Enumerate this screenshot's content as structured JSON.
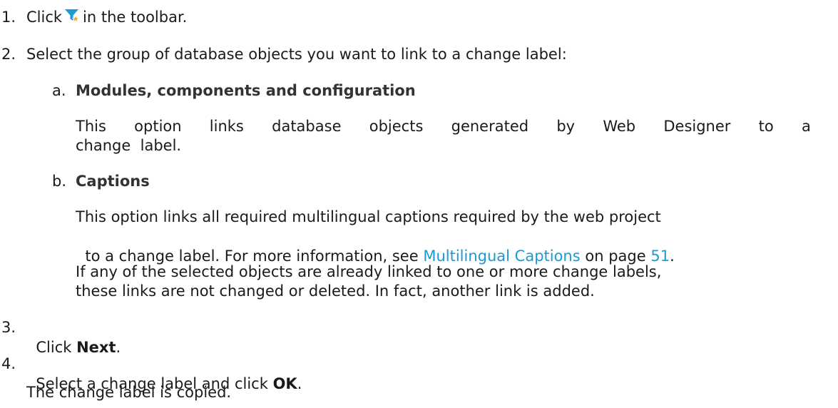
{
  "steps": [
    {
      "number": "1.",
      "before": "Click",
      "icon": "filter-star-icon",
      "after": "in the toolbar."
    },
    {
      "number": "2.",
      "text": "Select the group of database objects you want to link to a change label:",
      "options": [
        {
          "letter": "a.",
          "title": "Modules, components and configuration",
          "desc_line1": [
            "This option links database objects generated by Web Designer to a"
          ],
          "desc_line2": "change  label."
        },
        {
          "letter": "b.",
          "title": "Captions",
          "desc_line1": "This option links all required multilingual captions required by the web project",
          "desc_line2_before": "to a change label. For more information, see ",
          "desc_line2_link": "Multilingual Captions",
          "desc_line2_mid": " on page ",
          "desc_line2_page": "51",
          "desc_line2_after": ".",
          "note_line1": "If any of the selected objects are already linked to one or more change labels,",
          "note_line2": "these links are not changed or deleted. In fact, another link is added."
        }
      ]
    },
    {
      "number": "3.",
      "before": "Click ",
      "bold": "Next",
      "after": "."
    },
    {
      "number": "4.",
      "before": "Select a change label and click ",
      "bold": "OK",
      "after": ".",
      "result": "The change label is copied."
    }
  ],
  "colors": {
    "text": "#1a1a1a",
    "link": "#1a9ad6",
    "icon_funnel": "#1b9bd7",
    "icon_star": "#f5a623"
  }
}
